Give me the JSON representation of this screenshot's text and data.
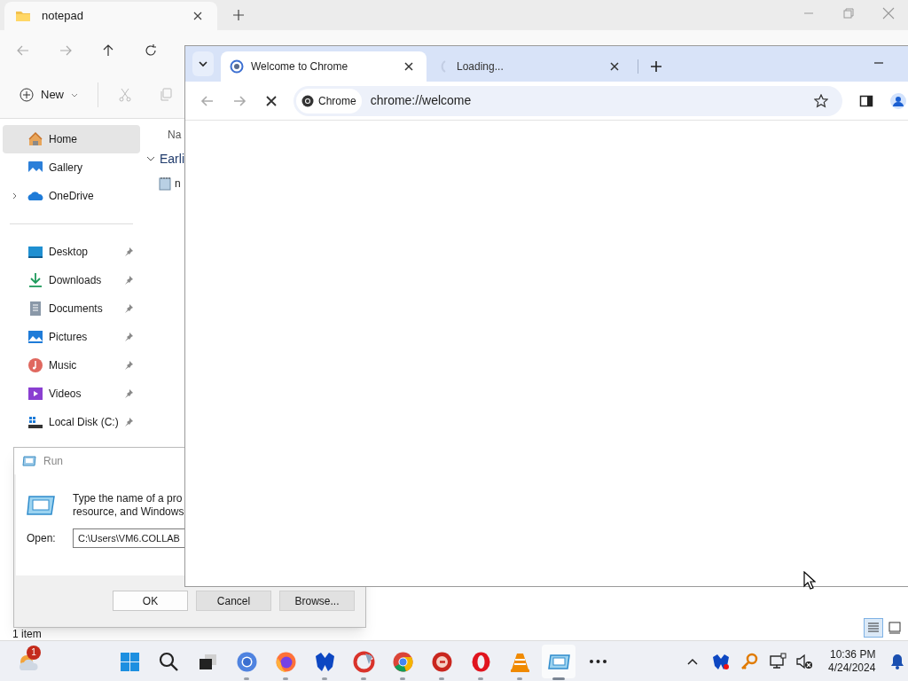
{
  "explorer": {
    "tabs": [
      {
        "label": "notepad",
        "selected": true
      }
    ],
    "new_label": "New",
    "sidebar": {
      "items": [
        {
          "kind": "home",
          "label": "Home",
          "selected": true
        },
        {
          "kind": "gallery",
          "label": "Gallery",
          "selected": false
        },
        {
          "kind": "onedrive",
          "label": "OneDrive",
          "selected": false,
          "expanded": false
        },
        {
          "kind": "divider"
        },
        {
          "kind": "desktop",
          "label": "Desktop",
          "selected": false,
          "pinned": true
        },
        {
          "kind": "downloads",
          "label": "Downloads",
          "selected": false,
          "pinned": true
        },
        {
          "kind": "documents",
          "label": "Documents",
          "selected": false,
          "pinned": true
        },
        {
          "kind": "pictures",
          "label": "Pictures",
          "selected": false,
          "pinned": true
        },
        {
          "kind": "music",
          "label": "Music",
          "selected": false,
          "pinned": true
        },
        {
          "kind": "videos",
          "label": "Videos",
          "selected": false,
          "pinned": true
        },
        {
          "kind": "disk",
          "label": "Local Disk (C:)",
          "selected": false,
          "pinned": true
        }
      ]
    },
    "column_1": "Na",
    "group": {
      "label": "Earli",
      "expanded": true
    },
    "files": [
      "n"
    ],
    "status_bar": "1 item",
    "views": [
      {
        "kind": "details",
        "selected": true
      },
      {
        "kind": "tiles",
        "selected": false
      }
    ]
  },
  "chrome": {
    "tabs": [
      {
        "label": "Welcome to Chrome",
        "selected": true
      },
      {
        "label": "Loading...",
        "selected": false
      }
    ],
    "chip": "Chrome",
    "url": "chrome://welcome"
  },
  "run_dialog": {
    "title": "Run",
    "description": [
      "Type the name of a pro",
      "resource, and Windows"
    ],
    "open_label": "Open:",
    "value": "C:\\Users\\VM6.COLLAB",
    "buttons": [
      {
        "label": "OK",
        "default": true
      },
      {
        "label": "Cancel",
        "default": false
      },
      {
        "label": "Browse...",
        "default": false
      }
    ]
  },
  "taskbar": {
    "weather_badge": "1",
    "apps": [
      {
        "kind": "start",
        "running": false,
        "active": false
      },
      {
        "kind": "search",
        "running": false,
        "active": false
      },
      {
        "kind": "taskview",
        "running": false,
        "active": false
      },
      {
        "kind": "chrome-beta",
        "running": true,
        "active": false
      },
      {
        "kind": "firefox",
        "running": true,
        "active": false
      },
      {
        "kind": "malwarebytes",
        "running": true,
        "active": false
      },
      {
        "kind": "ccleaner",
        "running": true,
        "active": false
      },
      {
        "kind": "chrome",
        "running": true,
        "active": false
      },
      {
        "kind": "redapp",
        "running": true,
        "active": false
      },
      {
        "kind": "opera",
        "running": true,
        "active": false
      },
      {
        "kind": "vlc",
        "running": true,
        "active": false
      },
      {
        "kind": "run",
        "running": true,
        "active": true
      },
      {
        "kind": "more",
        "running": false,
        "active": false
      }
    ],
    "time": "10:36 PM",
    "date": "4/24/2024"
  }
}
